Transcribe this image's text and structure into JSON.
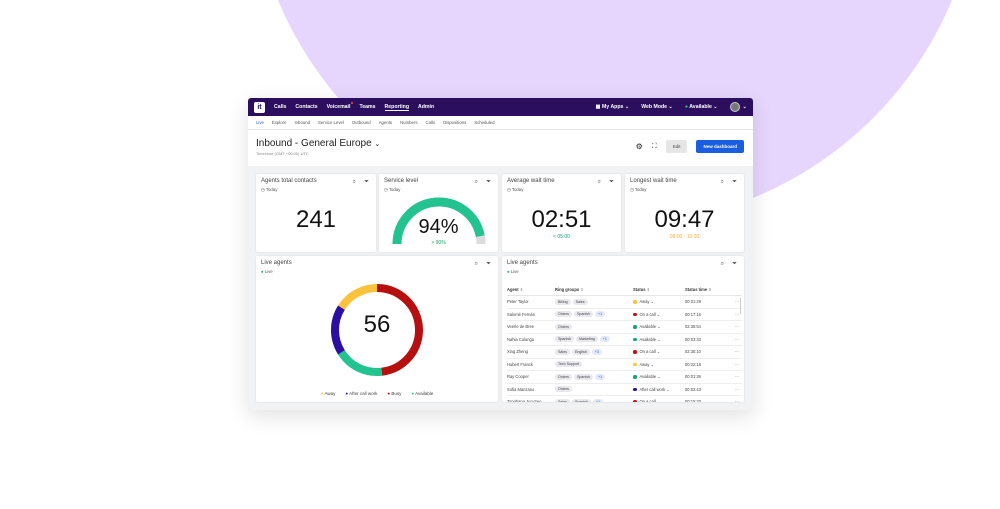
{
  "topnav": {
    "items": [
      "Calls",
      "Contacts",
      "Voicemail",
      "Teams",
      "Reporting",
      "Admin"
    ],
    "active": "Reporting",
    "my_apps": "My Apps",
    "web_mode": "Web Mode",
    "status": "Available",
    "logo": "it"
  },
  "subnav": {
    "items": [
      "Live",
      "Explore",
      "Inbound",
      "Service Level",
      "Outbound",
      "Agents",
      "Numbers",
      "Calls",
      "Dispositions",
      "Scheduled"
    ],
    "active": "Live"
  },
  "header": {
    "title": "Inbound - General Europe",
    "timezone": "Timezone (GMT +00:00) UTC",
    "edit": "Edit",
    "new_dashboard": "New dashboard"
  },
  "cards": {
    "contacts": {
      "title": "Agents total contacts",
      "period": "Today",
      "value": "241"
    },
    "service": {
      "title": "Service level",
      "period": "Today",
      "value": "94%",
      "target": "> 90%",
      "percent": 94
    },
    "avg_wait": {
      "title": "Average wait time",
      "period": "Today",
      "value": "02:51",
      "target": "< 05:00"
    },
    "longest_wait": {
      "title": "Longest wait time",
      "period": "Today",
      "value": "09:47",
      "target": "08:00 - 10:00"
    }
  },
  "donut": {
    "title": "Live agents",
    "status": "Live",
    "total": "56",
    "segments": [
      {
        "label": "Busy",
        "value": 27,
        "color": "#b50f0f"
      },
      {
        "label": "Available",
        "value": 10,
        "color": "#22c38e"
      },
      {
        "label": "After call work",
        "value": 10,
        "color": "#2a0fa0"
      },
      {
        "label": "Away",
        "value": 9,
        "color": "#fbc23c"
      }
    ],
    "legend": [
      "Away",
      "After call work",
      "Busy",
      "Available"
    ]
  },
  "table": {
    "title": "Live agents",
    "status": "Live",
    "columns": [
      "Agent",
      "Ring groups",
      "Status",
      "Status time"
    ],
    "rows": [
      {
        "agent": "Peter Taylor",
        "groups": [
          "Billing",
          "Sales"
        ],
        "more": "",
        "status": "Away",
        "time": "00:01:29"
      },
      {
        "agent": "Salomé Fernán",
        "groups": [
          "Orders",
          "Spanish"
        ],
        "more": "+1",
        "status": "On a call",
        "time": "00:17:16"
      },
      {
        "agent": "Veerle de Bree",
        "groups": [
          "Orders"
        ],
        "more": "",
        "status": "Available",
        "time": "02:35:54"
      },
      {
        "agent": "Nahia Colunga",
        "groups": [
          "Spanish",
          "Marketing"
        ],
        "more": "+1",
        "status": "Available",
        "time": "00:03:33"
      },
      {
        "agent": "Xing Zheng",
        "groups": [
          "Sales",
          "English"
        ],
        "more": "+3",
        "status": "On a call",
        "time": "02:30:10"
      },
      {
        "agent": "Hubert Franck",
        "groups": [
          "Tech Support"
        ],
        "more": "",
        "status": "Away",
        "time": "00:22:18"
      },
      {
        "agent": "Ray Cooper",
        "groups": [
          "Orders",
          "Spanish"
        ],
        "more": "+1",
        "status": "Available",
        "time": "00:01:36"
      },
      {
        "agent": "Sofia Manzano",
        "groups": [
          "Orders"
        ],
        "more": "",
        "status": "After call work",
        "time": "00:02:43"
      },
      {
        "agent": "Tongbang Jun-Seo",
        "groups": [
          "Sales",
          "Spanish"
        ],
        "more": "+1",
        "status": "On a call",
        "time": "00:15:20"
      }
    ]
  },
  "status_colors": {
    "Away": "#fbc23c",
    "On a call": "#c21010",
    "Available": "#16a36e",
    "After call work": "#2a0fa0"
  }
}
